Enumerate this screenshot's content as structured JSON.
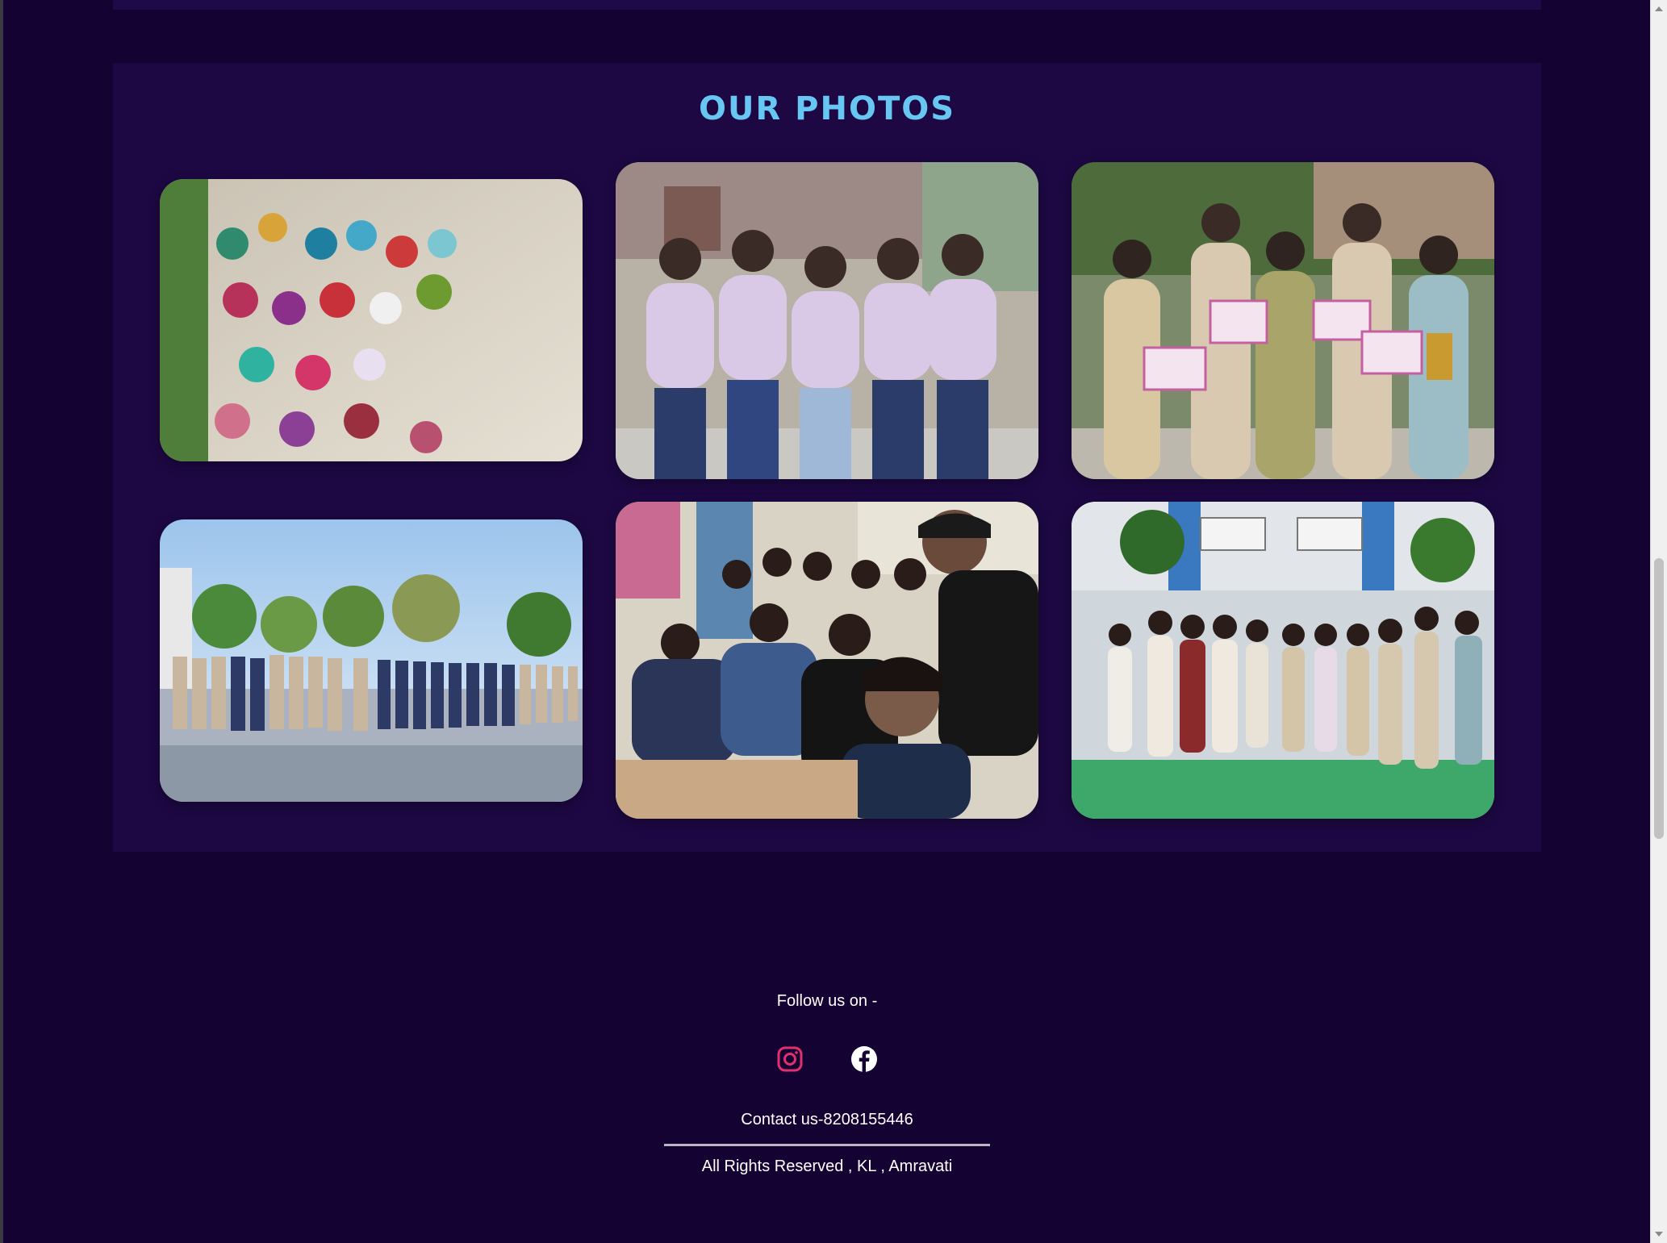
{
  "section": {
    "title": "OUR PHOTOS"
  },
  "photos": [
    {
      "name": "group-photo-traditional-wear"
    },
    {
      "name": "group-photo-five-friends"
    },
    {
      "name": "group-photo-certificates"
    },
    {
      "name": "group-photo-line-outdoor"
    },
    {
      "name": "group-photo-selfie-class"
    },
    {
      "name": "group-photo-campus"
    }
  ],
  "footer": {
    "follow_label": "Follow us on -",
    "contact": "Contact us-8208155446",
    "rights": "All Rights Reserved , KL , Amravati",
    "social": [
      {
        "icon": "instagram-icon",
        "color": "#e1306c"
      },
      {
        "icon": "facebook-icon",
        "color": "#ffffff"
      }
    ]
  },
  "colors": {
    "background": "#140233",
    "panel": "#1d0843",
    "accent": "#68c7f2"
  }
}
